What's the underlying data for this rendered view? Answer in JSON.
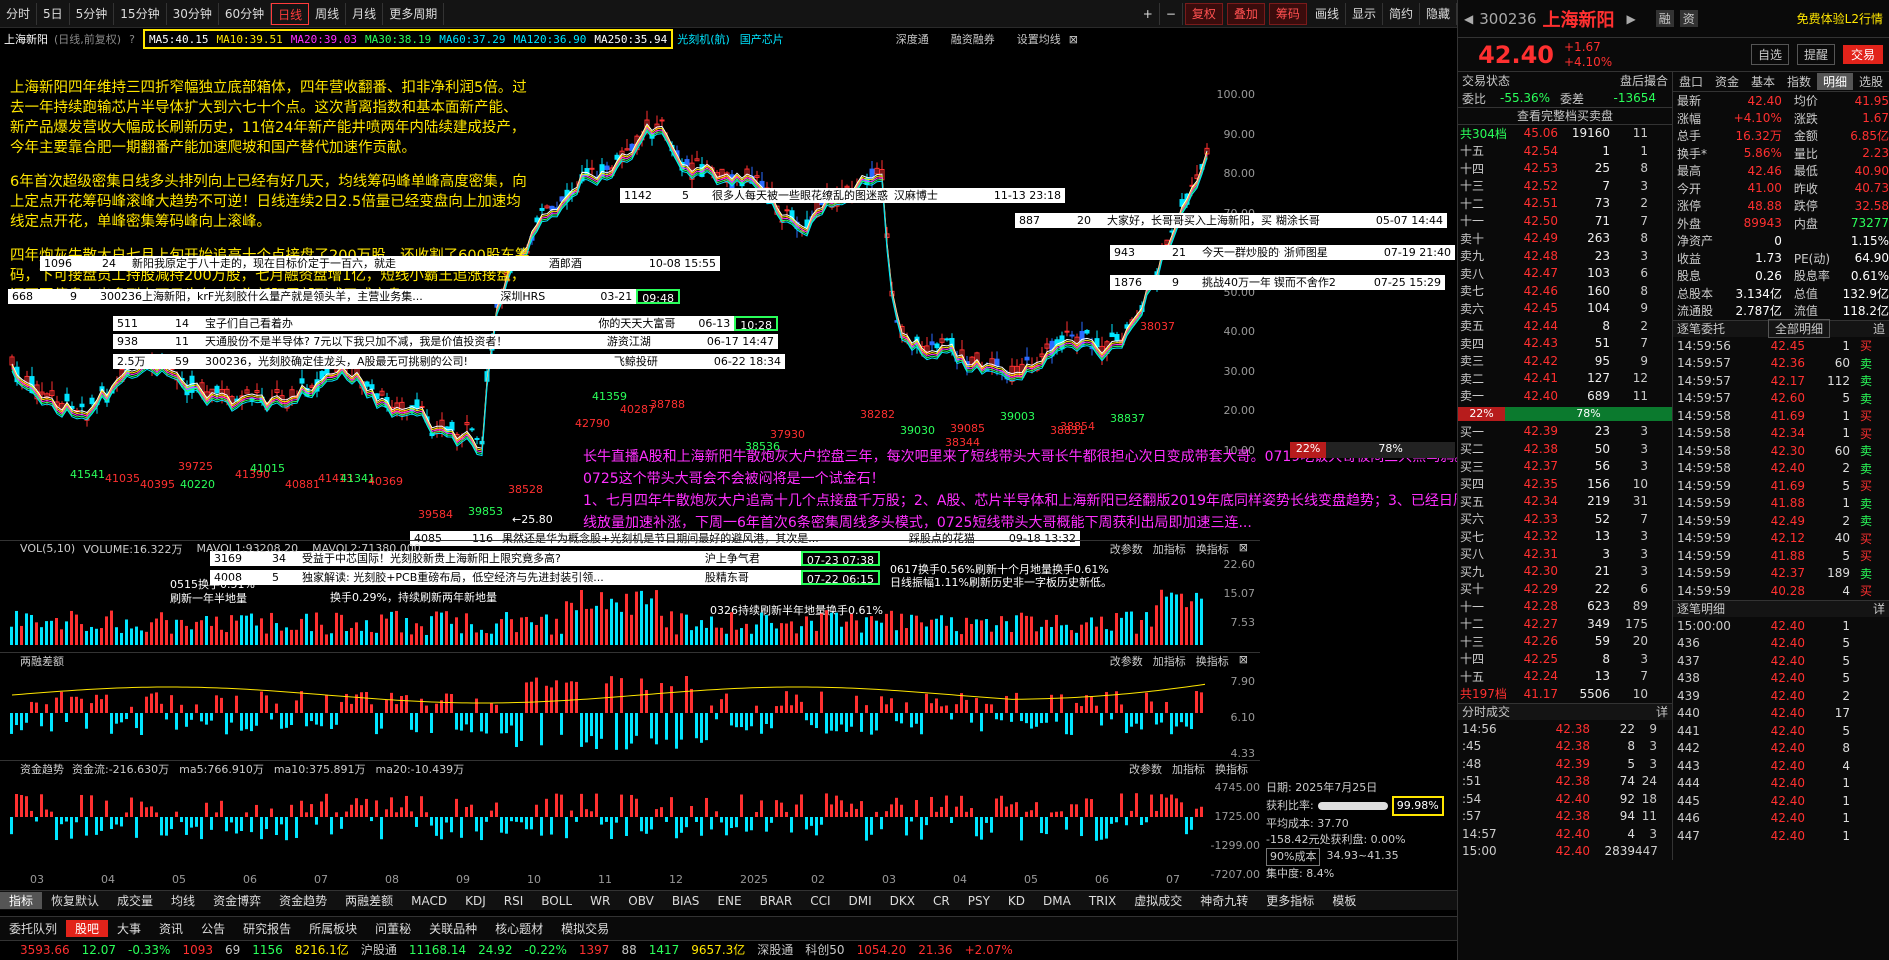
{
  "toolbar": {
    "periods": [
      "分时",
      "5日",
      "5分钟",
      "15分钟",
      "30分钟",
      "60分钟",
      "日线",
      "周线",
      "月线",
      "更多周期"
    ],
    "active_period": "日线",
    "right_buttons": [
      "复权",
      "叠加",
      "筹码",
      "画线",
      "显示",
      "简约",
      "隐藏"
    ]
  },
  "chart_header": {
    "stock": "上海新阳",
    "mode": "(日线,前复权)",
    "ma": {
      "ma5": "MA5:40.15",
      "ma10": "MA10:39.51",
      "ma20": "MA20:39.03",
      "ma30": "MA30:38.19",
      "ma60": "MA60:37.29",
      "ma120": "MA120:36.90",
      "ma250": "MA250:35.94"
    },
    "concept1": "光刻机(航)",
    "concept2": "国产芯片",
    "tools": [
      "深度通",
      "融资融券",
      "设置均线"
    ]
  },
  "y_axis": [
    "100.00",
    "90.00",
    "80.00",
    "70.00",
    "60.00",
    "50.00",
    "40.00",
    "30.00",
    "20.00",
    "10.00"
  ],
  "left_note": [
    "上海新阳四年维持三四折窄幅独立底部箱体，四年营收翻番、扣非净利润5倍。过去一年持续跑输芯片半导体扩大到六七十个点。这次背离指数和基本面新产能、新产品爆发营收大幅成长刷新历史，11倍24年新产能井喷两年内陆续建成投产，今年主要靠合肥一期翻番产能加速爬坡和国产替代加速作贡献。",
    "6年首次超级密集日线多头排列向上已经有好几天，均线筹码峰单峰高度密集，向上定点开花筹码峰滚峰大趋势不可逆！日线连续2日2.5倍量已经变盘向上加速均线定点开花，单峰密集筹码峰向上滚峰。",
    "四年炮灰牛散大户七月上旬开始追高十个点接盘了200万股，还收割了600股东筹码，下可接盘员工持股减持200万股，七月融资盘增1亿，短线小霸王追涨接盘，还不要停盘卖出多到上两只也在对上海新阳尾部形成了式变盘。"
  ],
  "comments": [
    {
      "id": "1142",
      "n": "5",
      "text": "很多人每天被一些眼花缭乱的图迷惑 我就说几个点！ 其他自行体...",
      "user": "汉麻博士",
      "time": "11-13 23:18"
    },
    {
      "id": "887",
      "n": "20",
      "text": "大家好，长哥哥买入上海新阳，买入价38.33元。",
      "user": "糊涂长哥",
      "time": "05-07 14:44"
    },
    {
      "id": "943",
      "n": "21",
      "text": "今天一群炒股的一起吃饭，要我推荐一只股票！能短时间大涨、...",
      "user": "浙师图星",
      "time": "07-19 21:40"
    },
    {
      "id": "1876",
      "n": "9",
      "text": "挑战40万一年内翻三倍日记",
      "user": "锲而不舍作2",
      "time": "07-25 15:29"
    },
    {
      "id": "1096",
      "n": "24",
      "text": "新阳我原定于八十走的，现在目标价定于一百六，就走",
      "user": "酒郎酒",
      "time": "10-08 15:55"
    },
    {
      "id": "668",
      "n": "9",
      "text": "300236上海新阳，krF光刻胶什么量产就是领头羊，主营业务集...",
      "user": "深圳HRS",
      "time": "03-21",
      "box": "09:48"
    },
    {
      "id": "511",
      "n": "14",
      "text": "宝子们自己看着办",
      "user": "你的天天大富哥",
      "time": "06-13",
      "box": "10:28"
    },
    {
      "id": "938",
      "n": "11",
      "text": "天通股份不是半导体? 7元以下我只加不减，我是价值投资者！",
      "user": "游资江湖",
      "time": "06-17 14:47"
    },
    {
      "id": "2.5万",
      "n": "59",
      "text": "300236，光刻胶确定佳龙头，A股最无可挑剔的公司!",
      "user": "飞鲸投研",
      "time": "06-22 18:34"
    },
    {
      "id": "4085",
      "n": "116",
      "text": "果然还是华为概念股+光刻机是节日期间最好的避风港，其次是...",
      "user": "踩股点的花猫",
      "time": "09-18 13:32"
    },
    {
      "id": "3169",
      "n": "34",
      "text": "受益于中芯国际！光刻胶新贵上海新阳上限究竟多高?",
      "user": "沪上争气君",
      "time": "",
      "box": "07-23 07:38"
    },
    {
      "id": "4008",
      "n": "5",
      "text": "独家解读: 光刻胶+PCB重磅布局，低空经济与先进封装引领...",
      "user": "股精东哥",
      "time": "",
      "box": "07-22 06:15"
    }
  ],
  "price_marks": [
    "41541",
    "41035",
    "40395",
    "40220",
    "39725",
    "41390",
    "41015",
    "40881",
    "41413",
    "41341",
    "40369",
    "39584",
    "39853",
    "38528",
    "42790",
    "41359",
    "40287",
    "38788",
    "38536",
    "37930",
    "38282",
    "39030",
    "38344",
    "39085",
    "39003",
    "38831",
    "38854",
    "38837",
    "38037"
  ],
  "low_mark": "←25.80",
  "mag_note": [
    "长牛直播A股和上海新阳牛散炮灰大户控盘三年，每次吧里来了短线带头大哥长牛都很担心次日变成带套大哥。0719吃饭大哥被闷三只黑乌鸦。0725这个带头大哥会不会被闷将是一个试金石！",
    "1、七月四年牛散炮灰大户追高十几个点接盘千万股；2、A股、芯片半导体和上海新阳已经翻版2019年底同样姿势长线变盘趋势；3、已经日周月线放量加速补涨，下周一6年首次6条密集周线多头模式，0725短线带头大哥概能下周获利出局即加速三连..."
  ],
  "chip": {
    "date": "日期: 2025年7月25日",
    "ratio_label": "获利比率:",
    "ratio": "99.98%",
    "cost_label": "平均成本: 37.70",
    "prob": "-158.42元处获利盘: 0.00%",
    "range_sel": "90%成本",
    "range": "34.93~41.35",
    "conc": "集中度: 8.4%",
    "pct_top": "22%",
    "pct_right": "78%"
  },
  "vol_panel": {
    "label": "VOL(5,10)",
    "vol": "VOLUME:16.322万",
    "mavol1": "MAVOL1:93208.20",
    "mavol2": "MAVOL2:71380.000",
    "ticks": [
      "22.60",
      "15.07",
      "7.53"
    ],
    "notes": [
      "0515换手0.51%",
      "刷新一年半地量",
      "换手0.29%，持续刷新两年新地量",
      "0326持续刷新半年地量换手0.61%",
      "0617换手0.56%刷新十个月地量换手0.61%",
      "日线振幅1.11%刷新历史非一字板历史新低。"
    ]
  },
  "margin_panel": {
    "label": "两融差额",
    "ticks": [
      "7.90",
      "6.10",
      "4.33"
    ]
  },
  "flow_panel": {
    "label": "资金趋势",
    "flow": "资金流:-216.630万",
    "ma5": "ma5:766.910万",
    "ma10": "ma10:375.891万",
    "ma20": "ma20:-10.439万",
    "ticks": [
      "4745.00",
      "1725.00",
      "-1299.00",
      "-7207.00"
    ]
  },
  "panel_tools": [
    "改参数",
    "加指标",
    "换指标"
  ],
  "x_axis": [
    "03",
    "04",
    "05",
    "06",
    "07",
    "08",
    "09",
    "10",
    "11",
    "12",
    "2025",
    "02",
    "03",
    "04",
    "05",
    "06",
    "07"
  ],
  "indicator_tabs": [
    "指标",
    "恢复默认",
    "成交量",
    "均线",
    "资金博弈",
    "资金趋势",
    "两融差额",
    "MACD",
    "KDJ",
    "RSI",
    "BOLL",
    "WR",
    "OBV",
    "BIAS",
    "ENE",
    "BRAR",
    "CCI",
    "DMI",
    "DKX",
    "CR",
    "PSY",
    "KD",
    "DMA",
    "TRIX",
    "虚拟成交",
    "神奇九转",
    "更多指标",
    "模板"
  ],
  "bottom_tabs": [
    "委托队列",
    "股吧",
    "大事",
    "资讯",
    "公告",
    "研究报告",
    "所属板块",
    "问董秘",
    "关联品种",
    "核心题材",
    "模拟交易"
  ],
  "active_bottom": "股吧",
  "ticker": {
    "sh": "3593.66",
    "sh_chg": "12.07",
    "sh_pct": "-0.33%",
    "a": "1093",
    "b": "69",
    "c": "1156",
    "amt": "8216.1亿",
    "hgt": "沪股通",
    "sz": "11168.14",
    "sz_chg": "24.92",
    "sz_pct": "-0.22%",
    "d": "1397",
    "e": "88",
    "f": "1417",
    "amt2": "9657.3亿",
    "sgt": "深股通",
    "kc_label": "科创50",
    "kc": "1054.20",
    "kc_chg": "21.36",
    "kc_pct": "+2.07%"
  },
  "right": {
    "code": "300236",
    "name": "上海新阳",
    "price": "42.40",
    "chg": "+1.67",
    "pct": "+4.10%",
    "pro": "免费体验L2行情",
    "btns": [
      "融",
      "资"
    ],
    "self": "自选",
    "remind": "提醒",
    "trade": "交易",
    "state": "交易状态",
    "after": "盘后撮合",
    "wb_l": "委比",
    "wb": "-55.36%",
    "wc_l": "委差",
    "wc": "-13654",
    "full": "查看完整档买卖盘",
    "sell_total": "共304档",
    "sell_total_p": "45.06",
    "sell_total_v": "19160",
    "sell_total_c": "11",
    "sells": [
      [
        "十五",
        "42.54",
        "1",
        "1"
      ],
      [
        "十四",
        "42.53",
        "25",
        "8"
      ],
      [
        "十三",
        "42.52",
        "7",
        "3"
      ],
      [
        "十二",
        "42.51",
        "73",
        "2"
      ],
      [
        "十一",
        "42.50",
        "71",
        "7"
      ],
      [
        "卖十",
        "42.49",
        "263",
        "8"
      ],
      [
        "卖九",
        "42.48",
        "23",
        "3"
      ],
      [
        "卖八",
        "42.47",
        "103",
        "6"
      ],
      [
        "卖七",
        "42.46",
        "160",
        "8"
      ],
      [
        "卖六",
        "42.45",
        "104",
        "9"
      ],
      [
        "卖五",
        "42.44",
        "8",
        "2"
      ],
      [
        "卖四",
        "42.43",
        "51",
        "7"
      ],
      [
        "卖三",
        "42.42",
        "95",
        "9"
      ],
      [
        "卖二",
        "42.41",
        "127",
        "12"
      ],
      [
        "卖一",
        "42.40",
        "689",
        "11"
      ]
    ],
    "bars": {
      "buy": "22%",
      "sell": "78%"
    },
    "buys": [
      [
        "买一",
        "42.39",
        "23",
        "3"
      ],
      [
        "买二",
        "42.38",
        "50",
        "3"
      ],
      [
        "买三",
        "42.37",
        "56",
        "3"
      ],
      [
        "买四",
        "42.35",
        "156",
        "10"
      ],
      [
        "买五",
        "42.34",
        "219",
        "31"
      ],
      [
        "买六",
        "42.33",
        "52",
        "7"
      ],
      [
        "买七",
        "42.32",
        "13",
        "3"
      ],
      [
        "买八",
        "42.31",
        "3",
        "3"
      ],
      [
        "买九",
        "42.30",
        "21",
        "3"
      ],
      [
        "买十",
        "42.29",
        "22",
        "6"
      ],
      [
        "十一",
        "42.28",
        "623",
        "89"
      ],
      [
        "十二",
        "42.27",
        "349",
        "175"
      ],
      [
        "十三",
        "42.26",
        "59",
        "20"
      ],
      [
        "十四",
        "42.25",
        "8",
        "3"
      ],
      [
        "十五",
        "42.24",
        "13",
        "7"
      ]
    ],
    "buy_total": "共197档",
    "buy_total_p": "41.17",
    "buy_total_v": "5506",
    "buy_total_c": "10",
    "tabs": [
      "盘口",
      "资金",
      "基本",
      "指数",
      "明细",
      "选股"
    ],
    "active_tab": "明细",
    "stats": [
      [
        "最新",
        "42.40",
        "均价",
        "41.95"
      ],
      [
        "涨幅",
        "+4.10%",
        "涨跌",
        "1.67"
      ],
      [
        "总手",
        "16.32万",
        "金额",
        "6.85亿"
      ],
      [
        "换手*",
        "5.86%",
        "量比",
        "2.23"
      ],
      [
        "最高",
        "42.46",
        "最低",
        "40.90"
      ],
      [
        "今开",
        "41.00",
        "昨收",
        "40.73"
      ],
      [
        "涨停",
        "48.88",
        "跌停",
        "32.58"
      ],
      [
        "外盘",
        "89943",
        "内盘",
        "73277"
      ]
    ],
    "stats2": [
      [
        "净资产",
        "0",
        "",
        "1.15%"
      ],
      [
        "收益",
        "1.73",
        "PE(动)",
        "64.90"
      ],
      [
        "股息",
        "0.26",
        "股息率",
        "0.61%"
      ],
      [
        "总股本",
        "3.134亿",
        "总值",
        "132.9亿"
      ],
      [
        "流通股",
        "2.787亿",
        "流值",
        "118.2亿"
      ]
    ],
    "entrust_label": "逐笔委托",
    "entrust_sel": "全部明细",
    "entrust_more": "追",
    "entrusts": [
      [
        "14:59:56",
        "42.45",
        "1",
        "买"
      ],
      [
        "14:59:57",
        "42.36",
        "60",
        "卖"
      ],
      [
        "14:59:57",
        "42.17",
        "112",
        "卖"
      ],
      [
        "14:59:57",
        "42.60",
        "5",
        "卖"
      ],
      [
        "14:59:58",
        "41.69",
        "1",
        "买"
      ],
      [
        "14:59:58",
        "42.34",
        "1",
        "买"
      ],
      [
        "14:59:58",
        "42.30",
        "60",
        "卖"
      ],
      [
        "14:59:58",
        "42.40",
        "2",
        "卖"
      ],
      [
        "14:59:59",
        "41.69",
        "5",
        "买"
      ],
      [
        "14:59:59",
        "41.88",
        "1",
        "卖"
      ],
      [
        "14:59:59",
        "42.49",
        "2",
        "卖"
      ],
      [
        "14:59:59",
        "42.12",
        "40",
        "买"
      ],
      [
        "14:59:59",
        "41.88",
        "5",
        "买"
      ],
      [
        "14:59:59",
        "42.37",
        "189",
        "卖"
      ],
      [
        "14:59:59",
        "40.28",
        "4",
        "买"
      ]
    ],
    "detail_label": "逐笔明细",
    "detail_more": "详",
    "details": [
      [
        "15:00:00",
        "42.40",
        "1"
      ],
      [
        "436",
        "42.40",
        "5"
      ],
      [
        "437",
        "42.40",
        "5"
      ],
      [
        "438",
        "42.40",
        "5"
      ],
      [
        "439",
        "42.40",
        "2"
      ],
      [
        "440",
        "42.40",
        "17"
      ],
      [
        "441",
        "42.40",
        "5"
      ],
      [
        "442",
        "42.40",
        "8"
      ],
      [
        "443",
        "42.40",
        "4"
      ],
      [
        "444",
        "42.40",
        "1"
      ],
      [
        "445",
        "42.40",
        "1"
      ],
      [
        "446",
        "42.40",
        "1"
      ],
      [
        "447",
        "42.40",
        "1"
      ]
    ],
    "ticks_label": "分时成交",
    "ticks_more": "详",
    "ticks": [
      [
        "14:56",
        "42.38",
        "22",
        "9"
      ],
      [
        ":45",
        "42.38",
        "8",
        "3"
      ],
      [
        ":48",
        "42.39",
        "5",
        "3"
      ],
      [
        ":51",
        "42.38",
        "74",
        "24"
      ],
      [
        ":54",
        "42.40",
        "92",
        "18"
      ],
      [
        ":57",
        "42.38",
        "94",
        "11"
      ],
      [
        "14:57",
        "42.40",
        "4",
        "3"
      ],
      [
        "15:00",
        "42.40",
        "2839",
        "447"
      ]
    ]
  },
  "colors": {
    "up": "#ff3030",
    "down": "#2aff5a",
    "ma5": "#ffffff",
    "ma10": "#ffe600",
    "ma20": "#ff30ff",
    "ma30": "#2aff5a",
    "ma60": "#00e5ff",
    "highlight": "#ffe600"
  }
}
